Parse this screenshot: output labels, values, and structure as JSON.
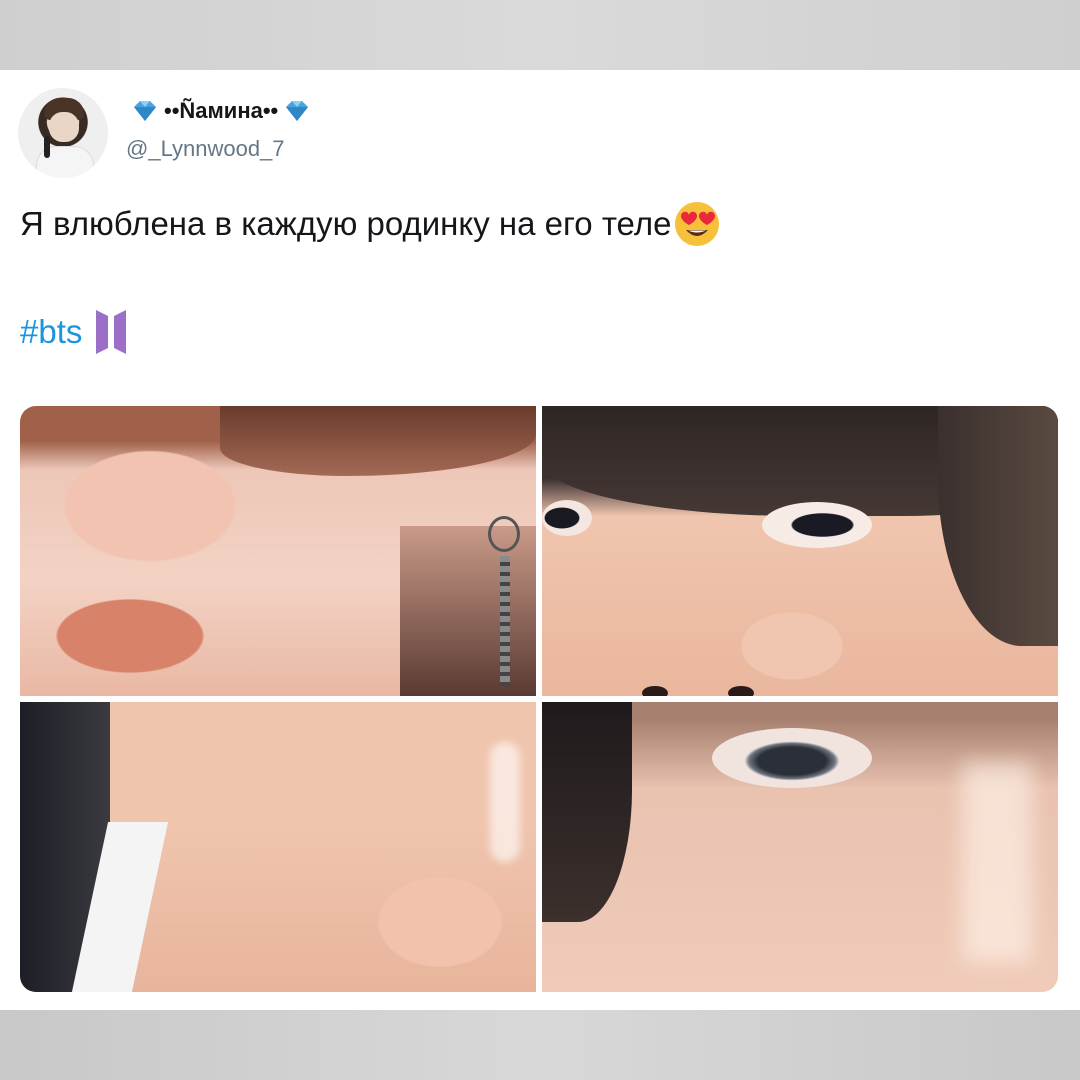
{
  "post": {
    "display_name": "••Ñамина••",
    "handle": "@_Lynnwood_7",
    "text": "Я влюблена в каждую родинку на его теле",
    "hashtag": "#bts",
    "name_icons": [
      "gem-icon",
      "gem-icon"
    ],
    "text_emoji": "heart-eyes-emoji-icon",
    "hashtag_icon": "bts-logo-icon",
    "photos_count": 4
  },
  "colors": {
    "card_bg": "#ffffff",
    "name": "#14171a",
    "handle": "#657786",
    "hashtag": "#1b95e0",
    "gem": "#4aa3df",
    "bts_logo": "#9b6fc7"
  }
}
